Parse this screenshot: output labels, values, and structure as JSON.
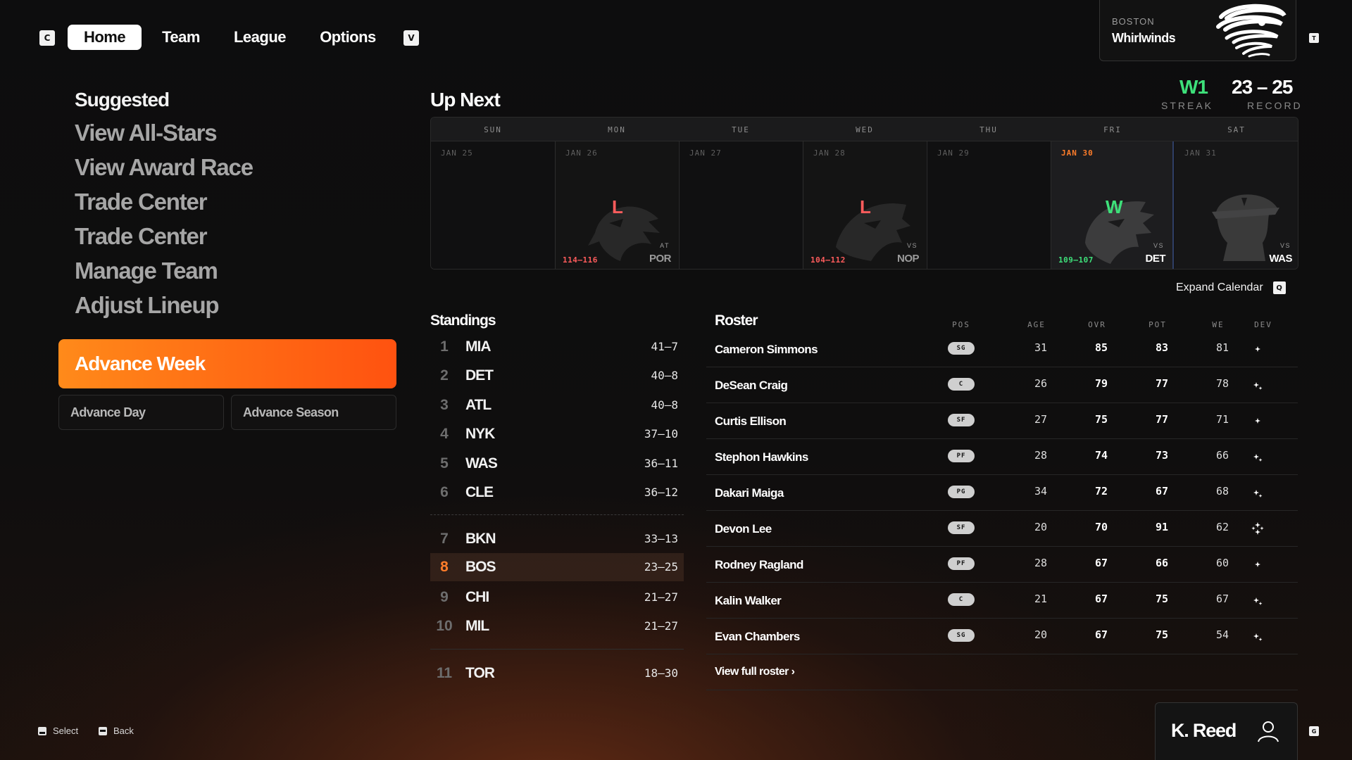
{
  "nav": {
    "left_key": "C",
    "right_key": "V",
    "tabs": [
      {
        "label": "Home",
        "active": true
      },
      {
        "label": "Team",
        "active": false
      },
      {
        "label": "League",
        "active": false
      },
      {
        "label": "Options",
        "active": false
      }
    ]
  },
  "team_card": {
    "city": "BOSTON",
    "name": "Whirlwinds",
    "key": "T",
    "logo_icon": "whirlwind-logo"
  },
  "header_stats": {
    "streak_value": "W1",
    "streak_label": "STREAK",
    "record_value": "23 – 25",
    "record_label": "RECORD"
  },
  "suggested": {
    "title": "Suggested",
    "items": [
      "View All-Stars",
      "View Award Race",
      "Trade Center",
      "Trade Center",
      "Manage Team",
      "Adjust Lineup"
    ]
  },
  "actions": {
    "advance_week": "Advance Week",
    "advance_day": "Advance Day",
    "advance_season": "Advance Season"
  },
  "up_next": {
    "title": "Up Next",
    "days": [
      {
        "dow": "SUN",
        "date": "JAN 25",
        "result": "",
        "score": "",
        "loc": "",
        "opp": "",
        "logo": ""
      },
      {
        "dow": "MON",
        "date": "JAN 26",
        "result": "L",
        "score": "114–116",
        "loc": "AT",
        "opp": "POR",
        "logo": "eagle-logo"
      },
      {
        "dow": "TUE",
        "date": "JAN 27",
        "result": "",
        "score": "",
        "loc": "",
        "opp": "",
        "logo": ""
      },
      {
        "dow": "WED",
        "date": "JAN 28",
        "result": "L",
        "score": "104–112",
        "loc": "VS",
        "opp": "NOP",
        "logo": "panther-logo"
      },
      {
        "dow": "THU",
        "date": "JAN 29",
        "result": "",
        "score": "",
        "loc": "",
        "opp": "",
        "logo": ""
      },
      {
        "dow": "FRI",
        "date": "JAN 30",
        "result": "W",
        "score": "109–107",
        "loc": "VS",
        "opp": "DET",
        "logo": "wolf-logo"
      },
      {
        "dow": "SAT",
        "date": "JAN 31",
        "result": "",
        "score": "",
        "loc": "VS",
        "opp": "WAS",
        "logo": "pirate-logo"
      }
    ],
    "expand_label": "Expand Calendar",
    "expand_key": "Q"
  },
  "standings": {
    "title": "Standings",
    "rows": [
      {
        "rank": "1",
        "team": "MIA",
        "record": "41–7"
      },
      {
        "rank": "2",
        "team": "DET",
        "record": "40–8"
      },
      {
        "rank": "3",
        "team": "ATL",
        "record": "40–8"
      },
      {
        "rank": "4",
        "team": "NYK",
        "record": "37–10"
      },
      {
        "rank": "5",
        "team": "WAS",
        "record": "36–11"
      },
      {
        "rank": "6",
        "team": "CLE",
        "record": "36–12"
      },
      {
        "rank": "7",
        "team": "BKN",
        "record": "33–13"
      },
      {
        "rank": "8",
        "team": "BOS",
        "record": "23–25"
      },
      {
        "rank": "9",
        "team": "CHI",
        "record": "21–27"
      },
      {
        "rank": "10",
        "team": "MIL",
        "record": "21–27"
      },
      {
        "rank": "11",
        "team": "TOR",
        "record": "18–30"
      }
    ]
  },
  "roster": {
    "title": "Roster",
    "columns": [
      "POS",
      "AGE",
      "OVR",
      "POT",
      "WE",
      "DEV"
    ],
    "players": [
      {
        "name": "Cameron Simmons",
        "pos": "SG",
        "age": "31",
        "ovr": "85",
        "pot": "83",
        "we": "81",
        "dev": "dev-one-icon"
      },
      {
        "name": "DeSean Craig",
        "pos": "C",
        "age": "26",
        "ovr": "79",
        "pot": "77",
        "we": "78",
        "dev": "dev-two-icon"
      },
      {
        "name": "Curtis Ellison",
        "pos": "SF",
        "age": "27",
        "ovr": "75",
        "pot": "77",
        "we": "71",
        "dev": "dev-one-icon"
      },
      {
        "name": "Stephon Hawkins",
        "pos": "PF",
        "age": "28",
        "ovr": "74",
        "pot": "73",
        "we": "66",
        "dev": "dev-two-icon"
      },
      {
        "name": "Dakari Maiga",
        "pos": "PG",
        "age": "34",
        "ovr": "72",
        "pot": "67",
        "we": "68",
        "dev": "dev-two-icon"
      },
      {
        "name": "Devon Lee",
        "pos": "SF",
        "age": "20",
        "ovr": "70",
        "pot": "91",
        "we": "62",
        "dev": "dev-four-icon"
      },
      {
        "name": "Rodney Ragland",
        "pos": "PF",
        "age": "28",
        "ovr": "67",
        "pot": "66",
        "we": "60",
        "dev": "dev-one-icon"
      },
      {
        "name": "Kalin Walker",
        "pos": "C",
        "age": "21",
        "ovr": "67",
        "pot": "75",
        "we": "67",
        "dev": "dev-two-icon"
      },
      {
        "name": "Evan Chambers",
        "pos": "SG",
        "age": "20",
        "ovr": "67",
        "pot": "75",
        "we": "54",
        "dev": "dev-two-icon"
      }
    ],
    "view_full": "View full roster ›"
  },
  "footer": {
    "select_label": "Select",
    "back_label": "Back",
    "user_name": "K. Reed",
    "user_key": "G"
  },
  "colors": {
    "accent": "#ff6a14",
    "win": "#3ee07a",
    "loss": "#ff5c5c",
    "bg": "#0e0e0f"
  }
}
